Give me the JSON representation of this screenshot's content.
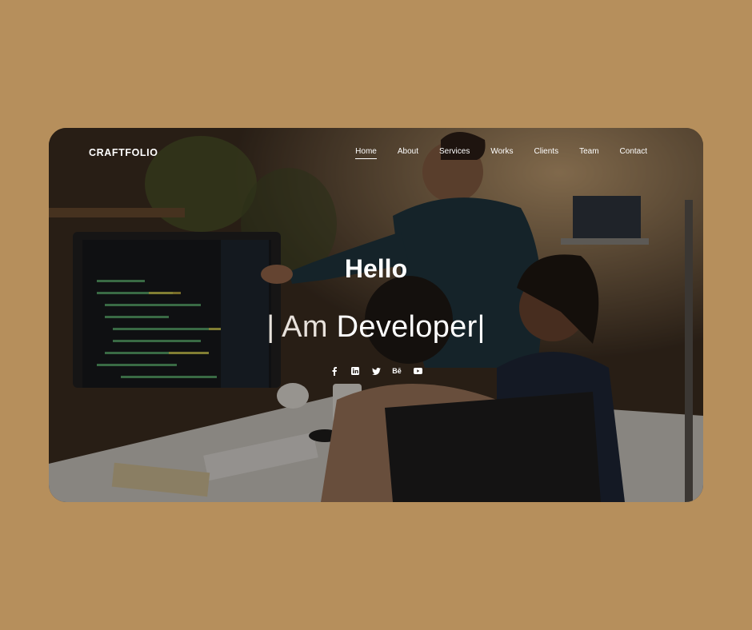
{
  "brand": "CRAFTFOLIO",
  "nav": {
    "items": [
      "Home",
      "About",
      "Services",
      "Works",
      "Clients",
      "Team",
      "Contact"
    ],
    "active": "Home"
  },
  "hero": {
    "greeting": "Hello",
    "tagline_prefix": "| Am ",
    "tagline_role": "Developer|"
  },
  "social_icons": [
    "facebook-icon",
    "linkedin-icon",
    "twitter-icon",
    "behance-icon",
    "youtube-icon"
  ],
  "colors": {
    "page_background": "#b68f5c",
    "text": "#ffffff"
  }
}
